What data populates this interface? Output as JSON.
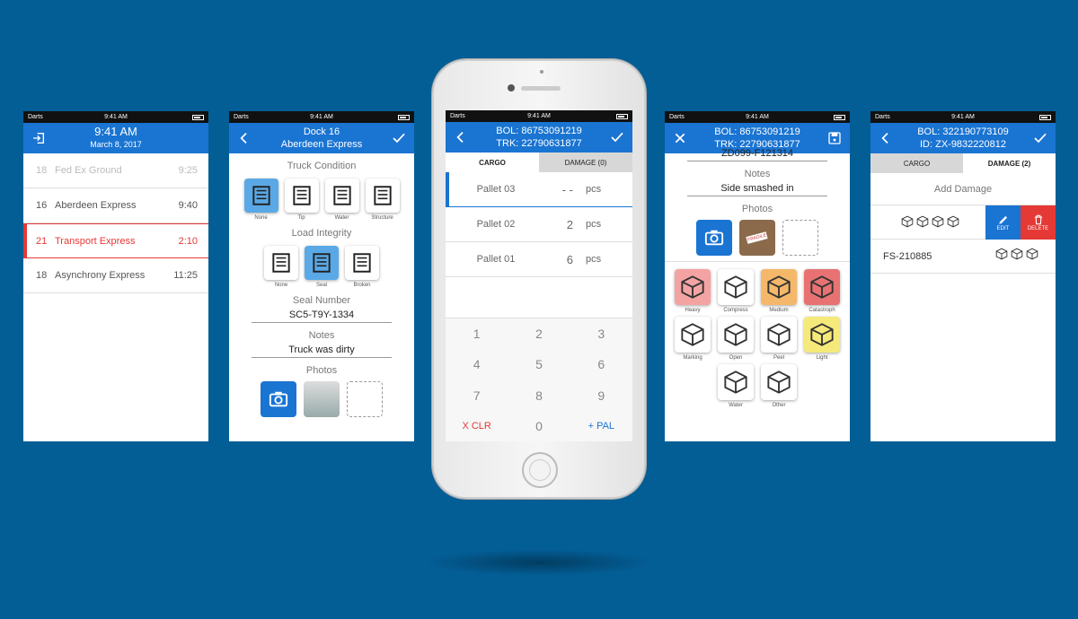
{
  "status_bar": {
    "carrier": "Darts",
    "time": "9:41 AM"
  },
  "screen1": {
    "header": {
      "time": "9:41 AM",
      "date": "March 8, 2017"
    },
    "rows": [
      {
        "num": "18",
        "name": "Fed Ex Ground",
        "time": "9:25"
      },
      {
        "num": "16",
        "name": "Aberdeen Express",
        "time": "9:40"
      },
      {
        "num": "21",
        "name": "Transport Express",
        "time": "2:10"
      },
      {
        "num": "18",
        "name": "Asynchrony Express",
        "time": "11:25"
      }
    ]
  },
  "screen2": {
    "header": {
      "line1": "Dock 16",
      "line2": "Aberdeen Express"
    },
    "truck_condition": {
      "label": "Truck Condition",
      "tiles": [
        "None",
        "Tip",
        "Water",
        "Structure"
      ]
    },
    "load_integrity": {
      "label": "Load Integrity",
      "tiles": [
        "None",
        "Seal",
        "Broken"
      ]
    },
    "seal_number": {
      "label": "Seal Number",
      "value": "SC5-T9Y-1334"
    },
    "notes": {
      "label": "Notes",
      "value": "Truck was dirty"
    },
    "photos": {
      "label": "Photos"
    }
  },
  "screen3": {
    "header": {
      "line1": "BOL: 86753091219",
      "line2": "TRK: 22790631877"
    },
    "tabs": [
      "CARGO",
      "DAMAGE (0)"
    ],
    "pallets": [
      {
        "name": "Pallet 03",
        "qty": "- -",
        "unit": "pcs"
      },
      {
        "name": "Pallet 02",
        "qty": "2",
        "unit": "pcs"
      },
      {
        "name": "Pallet 01",
        "qty": "6",
        "unit": "pcs"
      }
    ],
    "keypad": [
      "1",
      "2",
      "3",
      "4",
      "5",
      "6",
      "7",
      "8",
      "9",
      "X CLR",
      "0",
      "+ PAL"
    ]
  },
  "screen4": {
    "header": {
      "line1": "BOL: 86753091219",
      "line2": "TRK: 22790631877"
    },
    "top_cut": "ZD099-F121314",
    "notes": {
      "label": "Notes",
      "value": "Side smashed in"
    },
    "photos": {
      "label": "Photos",
      "stamp": "FRAGILE"
    },
    "damage_types": [
      {
        "label": "Heavy",
        "color": "#f4a3a3"
      },
      {
        "label": "Compress",
        "color": "#ffffff"
      },
      {
        "label": "Medium",
        "color": "#f5b86a"
      },
      {
        "label": "Catastroph",
        "color": "#e87272"
      },
      {
        "label": "Marking",
        "color": "#ffffff"
      },
      {
        "label": "Open",
        "color": "#ffffff"
      },
      {
        "label": "Peel",
        "color": "#ffffff"
      },
      {
        "label": "Light",
        "color": "#f5e97a"
      },
      {
        "label": "Water",
        "color": "#ffffff"
      },
      {
        "label": "Other",
        "color": "#ffffff"
      }
    ]
  },
  "screen5": {
    "header": {
      "line1": "BOL: 322190773109",
      "line2": "ID: ZX-9832220812"
    },
    "tabs": [
      "CARGO",
      "DAMAGE (2)"
    ],
    "add_damage": "Add Damage",
    "edit_label": "EDIT",
    "delete_label": "DELETE",
    "item": "FS-210885"
  },
  "colors": {
    "background": "#035e96",
    "header": "#1a74d2",
    "alert": "#e53935"
  }
}
